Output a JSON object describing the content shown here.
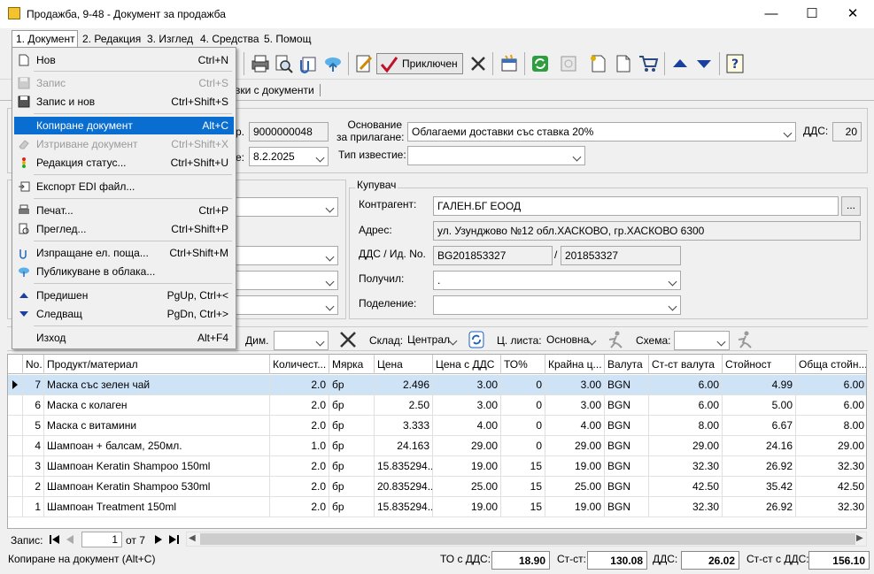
{
  "window": {
    "title": "Продажба, 9-48 - Документ за продажба",
    "minimize": "—",
    "maximize": "☐",
    "close": "✕"
  },
  "menubar": {
    "items": [
      "1. Документ",
      "2. Редакция",
      "3. Изглед",
      "4. Средства",
      "5. Помощ"
    ]
  },
  "toolbar": {
    "finish_label": "Приключен"
  },
  "tabs": {
    "partial_label": "вки с документи"
  },
  "header": {
    "number_label_partial": "р.",
    "number_value": "9000000048",
    "date_label_partial": "е:",
    "date_value": "8.2.2025",
    "basis_label": "Основание\nза прилагане:",
    "basis_value": "Облагаеми доставки със ставка 20%",
    "vat_label": "ДДС:",
    "vat_value": "20",
    "notice_label": "Тип известие:",
    "notice_value": ""
  },
  "buyer": {
    "group_label": "Купувач",
    "contractor_label": "Контрагент:",
    "contractor_value": "ГАЛЕН.БГ ЕООД",
    "browse": "...",
    "address_label": "Адрес:",
    "address_value": "ул. Узунджово  №12 обл.ХАСКОВО, гр.ХАСКОВО 6300",
    "vatid_label": "ДДС / Ид. No.",
    "vat_no": "BG201853327",
    "id_no": "201853327",
    "slash": "/",
    "received_label": "Получил:",
    "received_value": ".",
    "division_label": "Поделение:",
    "division_value": ""
  },
  "filters": {
    "dim_label": "Дим.",
    "warehouse_label": "Склад:",
    "warehouse_value": "Централ",
    "pricelist_label": "Ц. листа:",
    "pricelist_value": "Основна",
    "scheme_label": "Схема:",
    "scheme_value": ""
  },
  "grid": {
    "columns": [
      "No.",
      "Продукт/материал",
      "Количест...",
      "Мярка",
      "Цена",
      "Цена с ДДС",
      "ТО%",
      "Крайна ц...",
      "Валута",
      "Ст-ст валута",
      "Стойност",
      "Обща стойн..."
    ],
    "rows": [
      [
        "7",
        "Маска със зелен чай",
        "2.0",
        "бр",
        "2.496",
        "3.00",
        "0",
        "3.00",
        "BGN",
        "6.00",
        "4.99",
        "6.00"
      ],
      [
        "6",
        "Маска с колаген",
        "2.0",
        "бр",
        "2.50",
        "3.00",
        "0",
        "3.00",
        "BGN",
        "6.00",
        "5.00",
        "6.00"
      ],
      [
        "5",
        "Маска с витамини",
        "2.0",
        "бр",
        "3.333",
        "4.00",
        "0",
        "4.00",
        "BGN",
        "8.00",
        "6.67",
        "8.00"
      ],
      [
        "4",
        "Шампоан + балсам, 250мл.",
        "1.0",
        "бр",
        "24.163",
        "29.00",
        "0",
        "29.00",
        "BGN",
        "29.00",
        "24.16",
        "29.00"
      ],
      [
        "3",
        "Шампоан Keratin Shampoo 150ml",
        "2.0",
        "бр",
        "15.835294...",
        "19.00",
        "15",
        "19.00",
        "BGN",
        "32.30",
        "26.92",
        "32.30"
      ],
      [
        "2",
        "Шампоан Keratin Shampoo 530ml",
        "2.0",
        "бр",
        "20.835294...",
        "25.00",
        "15",
        "25.00",
        "BGN",
        "42.50",
        "35.42",
        "42.50"
      ],
      [
        "1",
        "Шампоан Treatment 150ml",
        "2.0",
        "бр",
        "15.835294...",
        "19.00",
        "15",
        "19.00",
        "BGN",
        "32.30",
        "26.92",
        "32.30"
      ]
    ],
    "selected_row": 0
  },
  "navigator": {
    "record_label": "Запис:",
    "record_value": "1",
    "of_label": "от 7"
  },
  "status": {
    "message": "Копиране на документ (Alt+C)",
    "to_label": "ТО с ДДС:",
    "to_value": "18.90",
    "cost_label": "Ст-ст:",
    "cost_value": "130.08",
    "vat_label": "ДДС:",
    "vat_value": "26.02",
    "total_label": "Ст-ст с ДДС:",
    "total_value": "156.10"
  },
  "dropdown": {
    "items": [
      {
        "label": "Нов",
        "shortcut": "Ctrl+N",
        "icon": "new-document-icon",
        "disabled": false
      },
      {
        "label": "Запис",
        "shortcut": "Ctrl+S",
        "icon": "save-icon",
        "disabled": true
      },
      {
        "label": "Запис и нов",
        "shortcut": "Ctrl+Shift+S",
        "icon": "save-new-icon",
        "disabled": false
      },
      {
        "label": "Копиране документ",
        "shortcut": "Alt+C",
        "icon": "copy-document-icon",
        "disabled": false,
        "highlighted": true
      },
      {
        "label": "Изтриване документ",
        "shortcut": "Ctrl+Shift+X",
        "icon": "eraser-icon",
        "disabled": true
      },
      {
        "label": "Редакция статус...",
        "shortcut": "Ctrl+Shift+U",
        "icon": "traffic-light-icon",
        "disabled": false
      },
      {
        "label": "Експорт EDI файл...",
        "shortcut": "",
        "icon": "export-icon",
        "disabled": false
      },
      {
        "label": "Печат...",
        "shortcut": "Ctrl+P",
        "icon": "printer-icon",
        "disabled": false
      },
      {
        "label": "Преглед...",
        "shortcut": "Ctrl+Shift+P",
        "icon": "preview-icon",
        "disabled": false
      },
      {
        "label": "Изпращане ел. поща...",
        "shortcut": "Ctrl+Shift+M",
        "icon": "mail-icon",
        "disabled": false
      },
      {
        "label": "Публикуване в облака...",
        "shortcut": "",
        "icon": "cloud-icon",
        "disabled": false
      },
      {
        "label": "Предишен",
        "shortcut": "PgUp, Ctrl+<",
        "icon": "arrow-up-icon",
        "disabled": false
      },
      {
        "label": "Следващ",
        "shortcut": "PgDn, Ctrl+>",
        "icon": "arrow-down-icon",
        "disabled": false
      },
      {
        "label": "Изход",
        "shortcut": "Alt+F4",
        "icon": "exit-icon",
        "disabled": false
      }
    ]
  }
}
